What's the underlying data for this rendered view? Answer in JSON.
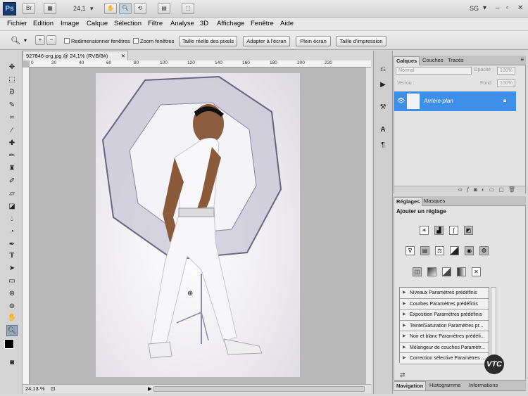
{
  "appbar": {
    "logo": "Ps",
    "bridge": "Br",
    "zoom": "24,1",
    "workspace": "SG"
  },
  "menu": [
    "Fichier",
    "Edition",
    "Image",
    "Calque",
    "Sélection",
    "Filtre",
    "Analyse",
    "3D",
    "Affichage",
    "Fenêtre",
    "Aide"
  ],
  "options": {
    "resize_windows": "Redimensionner fenêtres",
    "zoom_windows": "Zoom fenêtres",
    "actual_pixels": "Taille réelle des pixels",
    "fit_screen": "Adapter à l'écran",
    "full_screen": "Plein écran",
    "print_size": "Taille d'impression"
  },
  "document": {
    "tab_title": "927846-org.jpg @ 24,1% (RVB/8#)",
    "zoom_status": "24,13 %",
    "ruler_marks": [
      "0",
      "20",
      "40",
      "60",
      "80",
      "100",
      "120",
      "140",
      "160",
      "180",
      "200",
      "220"
    ]
  },
  "layers_panel": {
    "tabs": [
      "Calques",
      "Couches",
      "Tracés"
    ],
    "blend_mode": "Normal",
    "opacity_label": "Opacité :",
    "opacity_value": "100%",
    "lock_label": "Verrou :",
    "fill_label": "Fond :",
    "fill_value": "100%",
    "layer_name": "Arrière-plan"
  },
  "adjustments_panel": {
    "tabs": [
      "Réglages",
      "Masques"
    ],
    "heading": "Ajouter un réglage",
    "presets": [
      "Niveaux Paramètres prédéfinis",
      "Courbes Paramètres prédéfinis",
      "Exposition Paramètres prédéfinis",
      "Teinte/Saturation Paramètres pr...",
      "Noir et blanc Paramètres prédéfi...",
      "Mélangeur de couches Paramètr...",
      "Correction sélective Paramètres ..."
    ]
  },
  "nav_panel": {
    "tabs": [
      "Navigation",
      "Histogramme",
      "Informations"
    ]
  },
  "watermark": "VTC"
}
